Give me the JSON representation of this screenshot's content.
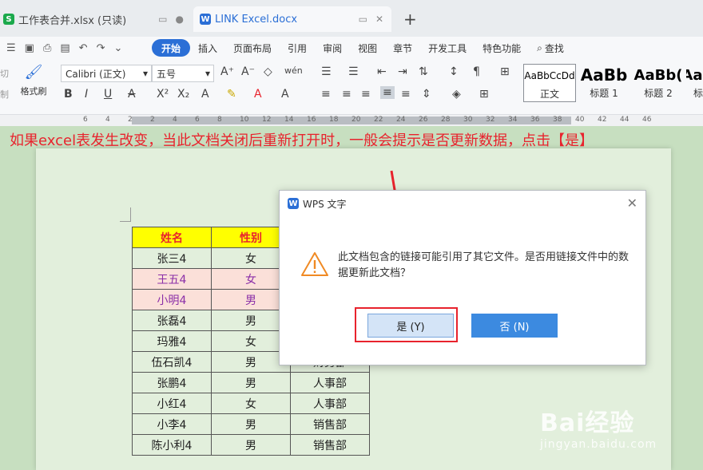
{
  "tabs": [
    {
      "badge": "S",
      "label": "工作表合并.xlsx (只读)"
    },
    {
      "badge": "W",
      "label": "LINK Excel.docx"
    }
  ],
  "new_tab": "+",
  "menu": {
    "items": [
      "开始",
      "插入",
      "页面布局",
      "引用",
      "审阅",
      "视图",
      "章节",
      "开发工具",
      "特色功能"
    ],
    "search": "查找"
  },
  "ribbon": {
    "cut": "切",
    "copy": "制",
    "format_painter": "格式刷",
    "font_name": "Calibri (正文)",
    "font_size": "五号",
    "styles": [
      {
        "sample": "AaBbCcDd",
        "name": "正文"
      },
      {
        "sample": "AaBb",
        "name": "标题 1"
      },
      {
        "sample": "AaBb(",
        "name": "标题 2"
      },
      {
        "sample": "AaH",
        "name": "标"
      }
    ]
  },
  "ruler": [
    "6",
    "4",
    "2",
    "2",
    "4",
    "6",
    "8",
    "10",
    "12",
    "14",
    "16",
    "18",
    "20",
    "22",
    "24",
    "26",
    "28",
    "30",
    "32",
    "34",
    "36",
    "38",
    "40",
    "42",
    "44",
    "46"
  ],
  "caption": "如果excel表发生改变，当此文档关闭后重新打开时，一般会提示是否更新数据，点击【是】",
  "table": {
    "headers": [
      "姓名",
      "性别",
      ""
    ],
    "rows": [
      [
        "张三4",
        "女",
        ""
      ],
      [
        "王五4",
        "女",
        ""
      ],
      [
        "小明4",
        "男",
        ""
      ],
      [
        "张磊4",
        "男",
        ""
      ],
      [
        "玛雅4",
        "女",
        ""
      ],
      [
        "伍石凯4",
        "男",
        "财务部"
      ],
      [
        "张鹏4",
        "男",
        "人事部"
      ],
      [
        "小红4",
        "女",
        "人事部"
      ],
      [
        "小李4",
        "男",
        "销售部"
      ],
      [
        "陈小利4",
        "男",
        "销售部"
      ]
    ]
  },
  "dialog": {
    "title": "WPS 文字",
    "message": "此文档包含的链接可能引用了其它文件。是否用链接文件中的数据更新此文档？",
    "yes": "是 (Y)",
    "no": "否 (N)"
  },
  "watermark": {
    "brand": "Bai经验",
    "url": "jingyan.baidu.com"
  },
  "colors": {
    "accent": "#2b6fd6",
    "annotation_red": "#e8232d",
    "header_yellow": "#ffff00"
  }
}
